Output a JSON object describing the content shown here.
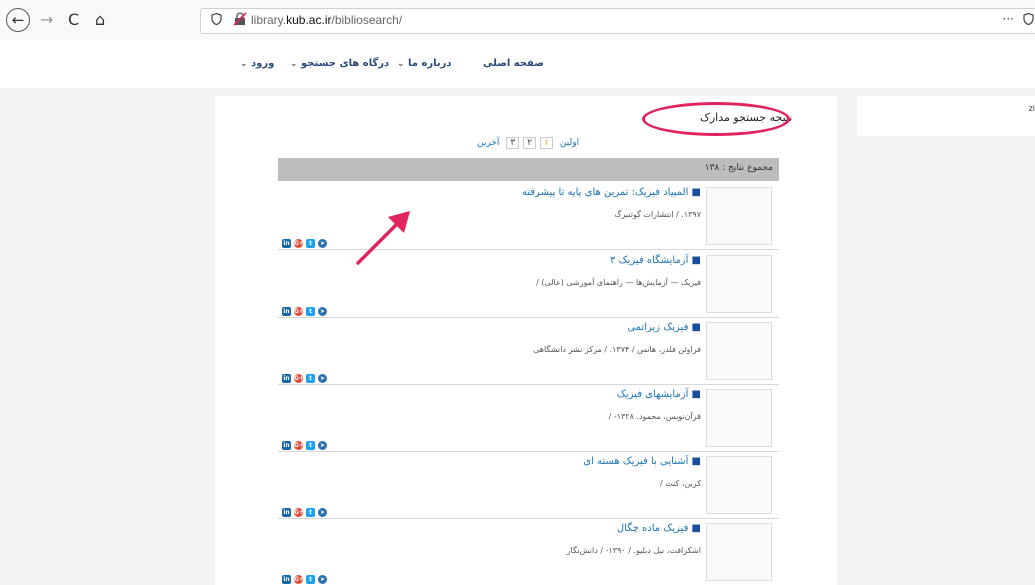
{
  "browser": {
    "back_icon": "←",
    "forward_icon": "→",
    "reload_icon": "C",
    "home_icon": "⌂",
    "url_prefix": "library.",
    "url_domain": "kub.ac.ir",
    "url_path": "/bibliosearch/",
    "menu_dots": "···"
  },
  "nav": {
    "home": "صفحه اصلی",
    "about": "درباره ما",
    "portals": "درگاه های جستجو",
    "login": "ورود",
    "chevron": "⌄"
  },
  "page": {
    "title": "نتیجه جستجو مدارک",
    "sidebox_text": "zi"
  },
  "pagination": {
    "first": "اولین",
    "pages": [
      "۱",
      "۲",
      "۳"
    ],
    "last": "آخرین"
  },
  "summary": "مجموع نتایج : ۱۳۸",
  "results": [
    {
      "title": "المپیاد فیزیک: تمرین های پایه تا پیشرفته",
      "meta": "۱۳۹۷. / انتشارات گوتنبرگ"
    },
    {
      "title": "آزمایشگاه فیزیک ۳",
      "meta": "فیزیک — آزمایش‌ها — راهنمای آموزشی (عالی) /"
    },
    {
      "title": "فیزیک زیراتمی",
      "meta": "فراوئن فلدر، هانس / ۱۳۷۴. / مرکز نشر دانشگاهی"
    },
    {
      "title": "آزمایشهای فیزیک",
      "meta": "قرآن‌نویس، محمود. ۱۳۲۸- /"
    },
    {
      "title": "آشنایی با فیزیک هسته ای",
      "meta": "کرین، کنث /"
    },
    {
      "title": "فیزیک ماده چگال",
      "meta": "اشکرافت، نیل دبلیو. / ۱۳۹۰- / دانش‌نگار"
    }
  ],
  "share_icons": [
    "in",
    "G+",
    "t",
    "➤"
  ],
  "colors": {
    "accent": "#1a73b5",
    "highlight": "#e0245e",
    "summary_bar": "#bdbdbd"
  }
}
